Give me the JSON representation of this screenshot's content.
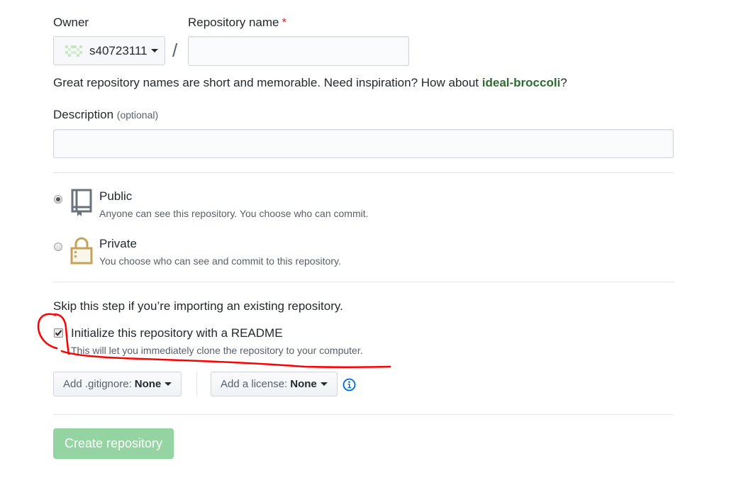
{
  "owner": {
    "label": "Owner",
    "name": "s40723111"
  },
  "repo": {
    "label": "Repository name",
    "required_mark": "*",
    "value": ""
  },
  "slash": "/",
  "hint": {
    "prefix": "Great repository names are short and memorable. Need inspiration? How about",
    "suggestion": "ideal-broccoli",
    "suffix": "?"
  },
  "description": {
    "label": "Description",
    "optional": "(optional)",
    "value": ""
  },
  "visibility": {
    "public": {
      "title": "Public",
      "desc": "Anyone can see this repository. You choose who can commit.",
      "selected": true
    },
    "private": {
      "title": "Private",
      "desc": "You choose who can see and commit to this repository.",
      "selected": false
    }
  },
  "init": {
    "skip_text": "Skip this step if you’re importing an existing repository.",
    "readme_label": "Initialize this repository with a README",
    "readme_desc": "This will let you immediately clone the repository to your computer.",
    "checked": true
  },
  "gitignore": {
    "label": "Add .gitignore:",
    "value": "None"
  },
  "license": {
    "label": "Add a license:",
    "value": "None"
  },
  "create_button": "Create repository",
  "colors": {
    "annotation": "#ff0000",
    "create_button": "#94d3a2",
    "info_icon": "#0366d6",
    "private_lock": "#c7a35a"
  },
  "icons": [
    "repo-book-icon",
    "lock-icon",
    "info-icon",
    "caret-down-icon"
  ]
}
